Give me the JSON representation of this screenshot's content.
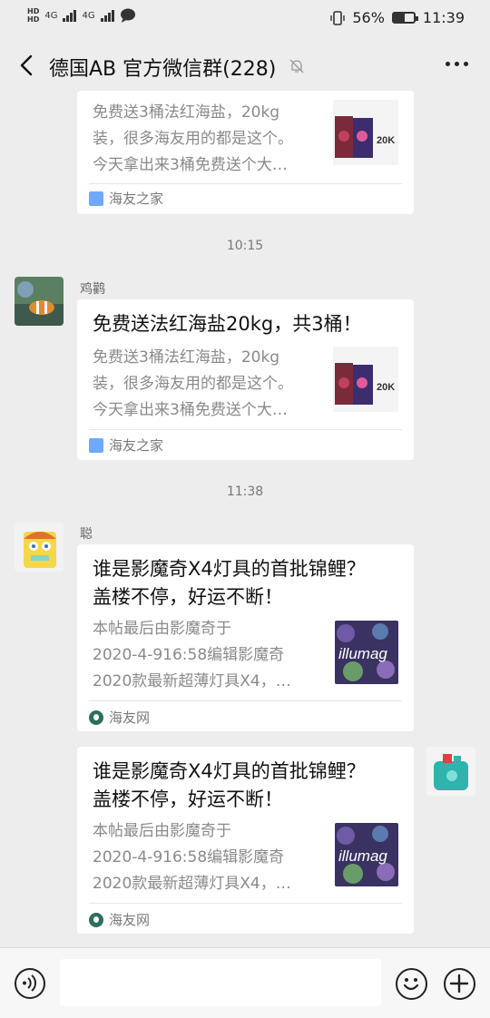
{
  "status": {
    "network": [
      "HD",
      "4G",
      "4G"
    ],
    "battery_pct": "56%",
    "battery_level": 0.56,
    "time": "11:39"
  },
  "header": {
    "title": "德国AB  官方微信群(228)"
  },
  "messages": [
    {
      "card": {
        "description": "免费送3桶法红海盐，20kg装，很多海友用的都是这个。今天拿出来3桶免费送个大…",
        "desc_lines": [
          "免费送3桶法红海盐，20kg",
          "装，很多海友用的都是这个。",
          "今天拿出来3桶免费送个大…"
        ],
        "thumb_label": "20K",
        "source": "海友之家"
      }
    },
    {
      "timestamp": "10:15",
      "sender": "鸡鹳",
      "card": {
        "title": "免费送法红海盐20kg，共3桶！",
        "desc_lines": [
          "免费送3桶法红海盐，20kg",
          "装，很多海友用的都是这个。",
          "今天拿出来3桶免费送个大…"
        ],
        "thumb_label": "20K",
        "source": "海友之家"
      }
    },
    {
      "timestamp": "11:38",
      "sender": "聪",
      "card": {
        "title_lines": [
          "谁是影魔奇X4灯具的首批锦鲤？",
          "盖楼不停，好运不断！"
        ],
        "desc_lines": [
          "本帖最后由影魔奇于",
          "2020-4-916:58编辑影魔奇",
          "2020款最新超薄灯具X4，…"
        ],
        "thumb_label": "illumag",
        "source": "海友网"
      }
    },
    {
      "card": {
        "title_lines": [
          "谁是影魔奇X4灯具的首批锦鲤？",
          "盖楼不停，好运不断！"
        ],
        "desc_lines": [
          "本帖最后由影魔奇于",
          "2020-4-916:58编辑影魔奇",
          "2020款最新超薄灯具X4，…"
        ],
        "thumb_label": "illumag",
        "source": "海友网"
      }
    }
  ],
  "colors": {
    "background": "#ededed",
    "card": "#ffffff",
    "muted_text": "#8a8a8a"
  }
}
